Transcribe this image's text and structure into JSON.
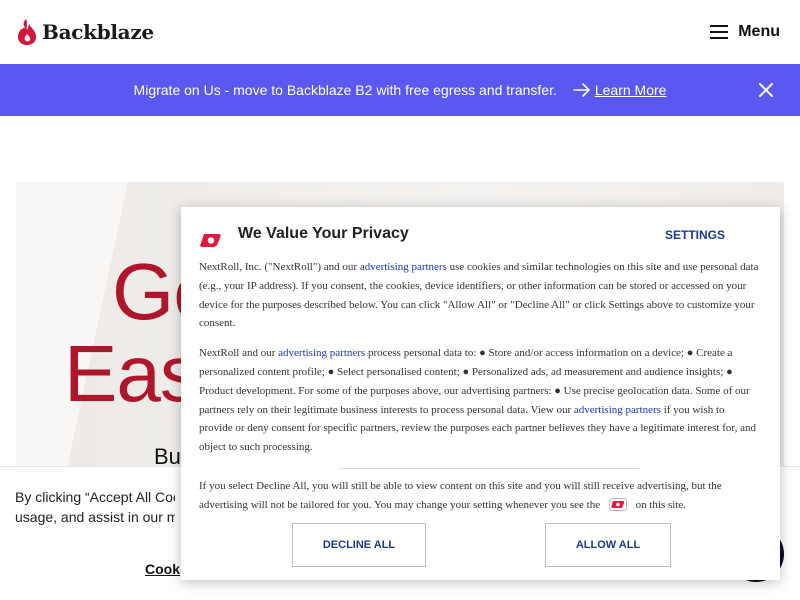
{
  "header": {
    "brand": "Backblaze",
    "menu_label": "Menu"
  },
  "promo": {
    "text": "Migrate on Us - move to Backblaze B2 with free egress and transfer.",
    "link": "Learn More"
  },
  "hero": {
    "line1": "Ge",
    "line2": "Eas",
    "sub": "Bu"
  },
  "cookie_bar": {
    "line1": "By clicking “Accept All Cook",
    "line2": "usage, and assist in our mark",
    "settings_link": "Cook"
  },
  "modal": {
    "title": "We Value Your Privacy",
    "settings_label": "SETTINGS",
    "p1_a": "NextRoll, Inc. (\"NextRoll\") and our ",
    "p1_link": "advertising partners",
    "p1_b": " use cookies and similar technologies on this site and use personal data (e.g., your IP address). If you consent, the cookies, device identifiers, or other information can be stored or accessed on your device for the purposes described below. You can click \"Allow All\" or \"Decline All\" or click Settings above to customize your consent.",
    "p2_a": "NextRoll and our ",
    "p2_link": "advertising partners",
    "p2_b": " process personal data to: ● Store and/or access information on a device; ● Create a personalized content profile; ● Select personalised content; ● Personalized ads, ad measurement and audience insights; ● Product development. For some of the purposes above, our advertising partners: ● Use precise geolocation data. Some of our partners rely on their legitimate business interests to process personal data. View our ",
    "p2_link2": "advertising partners",
    "p2_c": " if you wish to provide or deny consent for specific partners, review the purposes each partner believes they have a legitimate interest for, and object to such processing.",
    "p3_a": "If you select Decline All, you will still be able to view content on this site and you will still receive advertising, but the advertising will not be tailored for you. You may change your setting whenever you see the ",
    "p3_b": " on this site.",
    "decline_label": "DECLINE ALL",
    "allow_label": "ALLOW ALL"
  },
  "colors": {
    "promo_bg": "#5a58f0",
    "hero_red": "#b0162b",
    "modal_link": "#1a34c8",
    "dark_navy": "#0d0c2c"
  },
  "icons": {
    "logo": "flame-icon",
    "menu": "hamburger-icon",
    "promo_arrow": "arrow-right-icon",
    "promo_close": "close-icon",
    "modal_logo": "nextroll-icon"
  }
}
